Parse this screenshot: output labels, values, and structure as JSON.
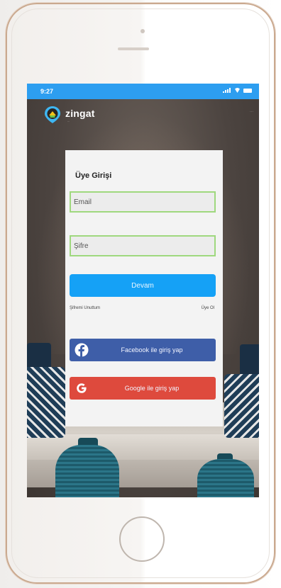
{
  "status_bar": {
    "time": "9:27"
  },
  "app": {
    "logo_text": "zingat",
    "logo_tagline": "...",
    "top_right_text": "..."
  },
  "login": {
    "title": "Üye Girişi",
    "email_placeholder": "Email",
    "password_placeholder": "Şifre",
    "continue_label": "Devam",
    "forgot_password_label": "Şifremi Unuttum",
    "signup_label": "Üye Ol",
    "facebook_label": "Facebook ile giriş yap",
    "google_label": "Google ile giriş yap"
  },
  "colors": {
    "status_bar": "#2d9ef0",
    "primary_button": "#15a1f6",
    "facebook": "#3e5ea8",
    "google": "#de4a3d",
    "input_border": "#9fd87e"
  },
  "icons": [
    "signal-icon",
    "wifi-icon",
    "battery-icon",
    "zingat-logo-icon",
    "facebook-icon",
    "google-icon"
  ]
}
